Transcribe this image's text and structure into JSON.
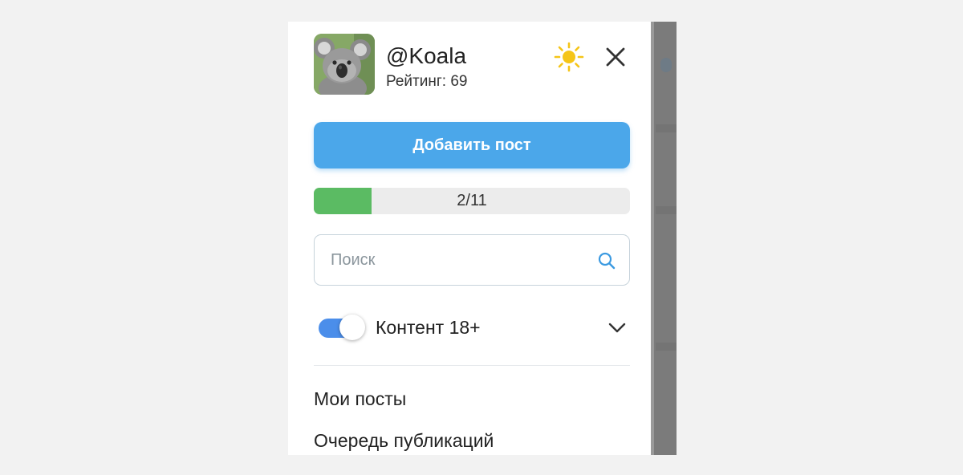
{
  "profile": {
    "username": "@Koala",
    "rating_text": "Рейтинг: 69"
  },
  "add_post": {
    "label": "Добавить пост"
  },
  "progress": {
    "text": "2/11",
    "current": 2,
    "total": 11
  },
  "search": {
    "placeholder": "Поиск",
    "value": ""
  },
  "content_filter": {
    "label": "Контент 18+",
    "enabled": true
  },
  "menu": {
    "items": [
      {
        "label": "Мои посты"
      },
      {
        "label": "Очередь публикаций"
      }
    ]
  },
  "icons": {
    "theme": "sun-icon",
    "close": "close-icon",
    "search": "search-icon",
    "expand": "chevron-down-icon"
  },
  "colors": {
    "accent": "#4ba7ea",
    "progress_fill": "#5bbb63",
    "toggle_on": "#4b8eea",
    "sun": "#f5c518"
  }
}
